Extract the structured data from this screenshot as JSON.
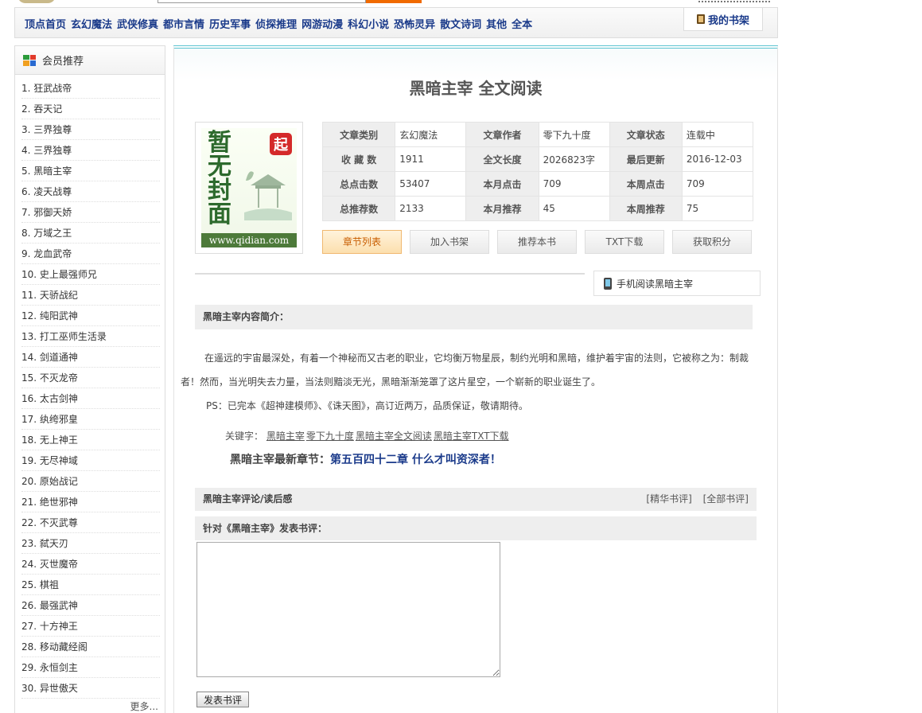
{
  "nav": {
    "items": [
      "顶点首页",
      "玄幻魔法",
      "武侠修真",
      "都市言情",
      "历史军事",
      "侦探推理",
      "网游动漫",
      "科幻小说",
      "恐怖灵异",
      "散文诗词",
      "其他",
      "全本"
    ],
    "shelf_label": "我的书架"
  },
  "sidebar": {
    "title": "会员推荐",
    "items": [
      "1. 狂武战帝",
      "2. 吞天记",
      "3. 三界独尊",
      "4. 三界独尊",
      "5. 黑暗主宰",
      "6. 凌天战尊",
      "7. 邪御天娇",
      "8. 万域之王",
      "9. 龙血武帝",
      "10. 史上最强师兄",
      "11. 天骄战纪",
      "12. 纯阳武神",
      "13. 打工巫师生活录",
      "14. 剑道通神",
      "15. 不灭龙帝",
      "16. 太古剑神",
      "17. 纨绔邪皇",
      "18. 无上神王",
      "19. 无尽神域",
      "20. 原始战记",
      "21. 绝世邪神",
      "22. 不灭武尊",
      "23. 弑天刃",
      "24. 灭世魔帝",
      "25. 棋祖",
      "26. 最强武神",
      "27. 十方神王",
      "28. 移动藏经阁",
      "29. 永恒剑主",
      "30. 异世傲天"
    ],
    "more": "更多..."
  },
  "book": {
    "title": "黑暗主宰 全文阅读",
    "cover": {
      "chars": [
        "暂",
        "无",
        "封",
        "面"
      ],
      "seal": "起",
      "url": "www.qidian.com"
    },
    "info": [
      [
        "文章类别",
        "玄幻魔法",
        "文章作者",
        "零下九十度",
        "文章状态",
        "连载中"
      ],
      [
        "收 藏 数",
        "1911",
        "全文长度",
        "2026823字",
        "最后更新",
        "2016-12-03"
      ],
      [
        "总点击数",
        "53407",
        "本月点击",
        "709",
        "本周点击",
        "709"
      ],
      [
        "总推荐数",
        "2133",
        "本月推荐",
        "45",
        "本周推荐",
        "75"
      ]
    ],
    "buttons": [
      "章节列表",
      "加入书架",
      "推荐本书",
      "TXT下载",
      "获取积分"
    ],
    "mobile_link": "手机阅读黑暗主宰",
    "intro_head": "黑暗主宰内容简介：",
    "intro": "在遥远的宇宙最深处，有着一个神秘而又古老的职业，它均衡万物星辰，制约光明和黑暗，维护着宇宙的法则，它被称之为：制裁者！然而，当光明失去力量，当法则黯淡无光，黑暗渐渐笼罩了这片星空，一个崭新的职业诞生了。",
    "ps": "PS：已完本《超神建模师》、《诛天图》，高订近两万，品质保证，敬请期待。",
    "keywords_label": "关键字：",
    "keywords": [
      "黑暗主宰",
      "零下九十度",
      "黑暗主宰全文阅读",
      "黑暗主宰TXT下载"
    ],
    "latest_label": "黑暗主宰最新章节：",
    "latest_chapter": "第五百四十二章 什么才叫资深者！"
  },
  "review": {
    "head": "黑暗主宰评论/读后感",
    "link_best": "[精华书评]",
    "link_all": "[全部书评]",
    "sub": "针对《黑暗主宰》发表书评：",
    "submit": "发表书评"
  }
}
